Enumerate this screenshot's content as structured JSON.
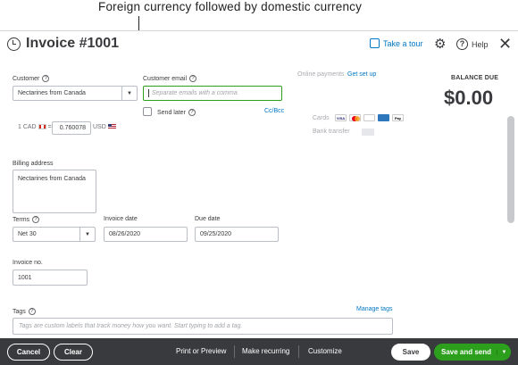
{
  "annotation": {
    "text": "Foreign currency followed by domestic currency"
  },
  "header": {
    "title": "Invoice #1001",
    "tour_label": "Take a tour",
    "help_label": "Help"
  },
  "customer": {
    "label": "Customer",
    "value": "Nectarines from Canada"
  },
  "email": {
    "label": "Customer email",
    "placeholder": "Separate emails with a comma",
    "send_later_label": "Send later",
    "cc_bcc_label": "Cc/Bcc"
  },
  "payments": {
    "online_label": "Online payments",
    "get_set_up": "Get set up",
    "cards_label": "Cards",
    "bank_label": "Bank transfer",
    "card_logos": [
      "VISA",
      "MC",
      "AMEX",
      "DISC",
      "Pay"
    ]
  },
  "balance": {
    "label": "BALANCE DUE",
    "value": "$0.00"
  },
  "currency": {
    "foreign_prefix": "1 CAD",
    "equals": "=",
    "rate": "0.760078",
    "home_code": "USD"
  },
  "billing": {
    "label": "Billing address",
    "value": "Nectarines from Canada"
  },
  "terms": {
    "label": "Terms",
    "value": "Net 30"
  },
  "invoice_date": {
    "label": "Invoice date",
    "value": "08/26/2020"
  },
  "due_date": {
    "label": "Due date",
    "value": "09/25/2020"
  },
  "invoice_no": {
    "label": "Invoice no.",
    "value": "1001"
  },
  "tags": {
    "label": "Tags",
    "manage_label": "Manage tags",
    "placeholder": "Tags are custom labels that track money how you want. Start typing to add a tag."
  },
  "footer": {
    "cancel": "Cancel",
    "clear": "Clear",
    "print_preview": "Print or Preview",
    "make_recurring": "Make recurring",
    "customize": "Customize",
    "save": "Save",
    "save_and_send": "Save and send"
  },
  "colors": {
    "accent_blue": "#0077c5",
    "accent_green": "#2ca01c",
    "footer_bg": "#393a3d"
  }
}
